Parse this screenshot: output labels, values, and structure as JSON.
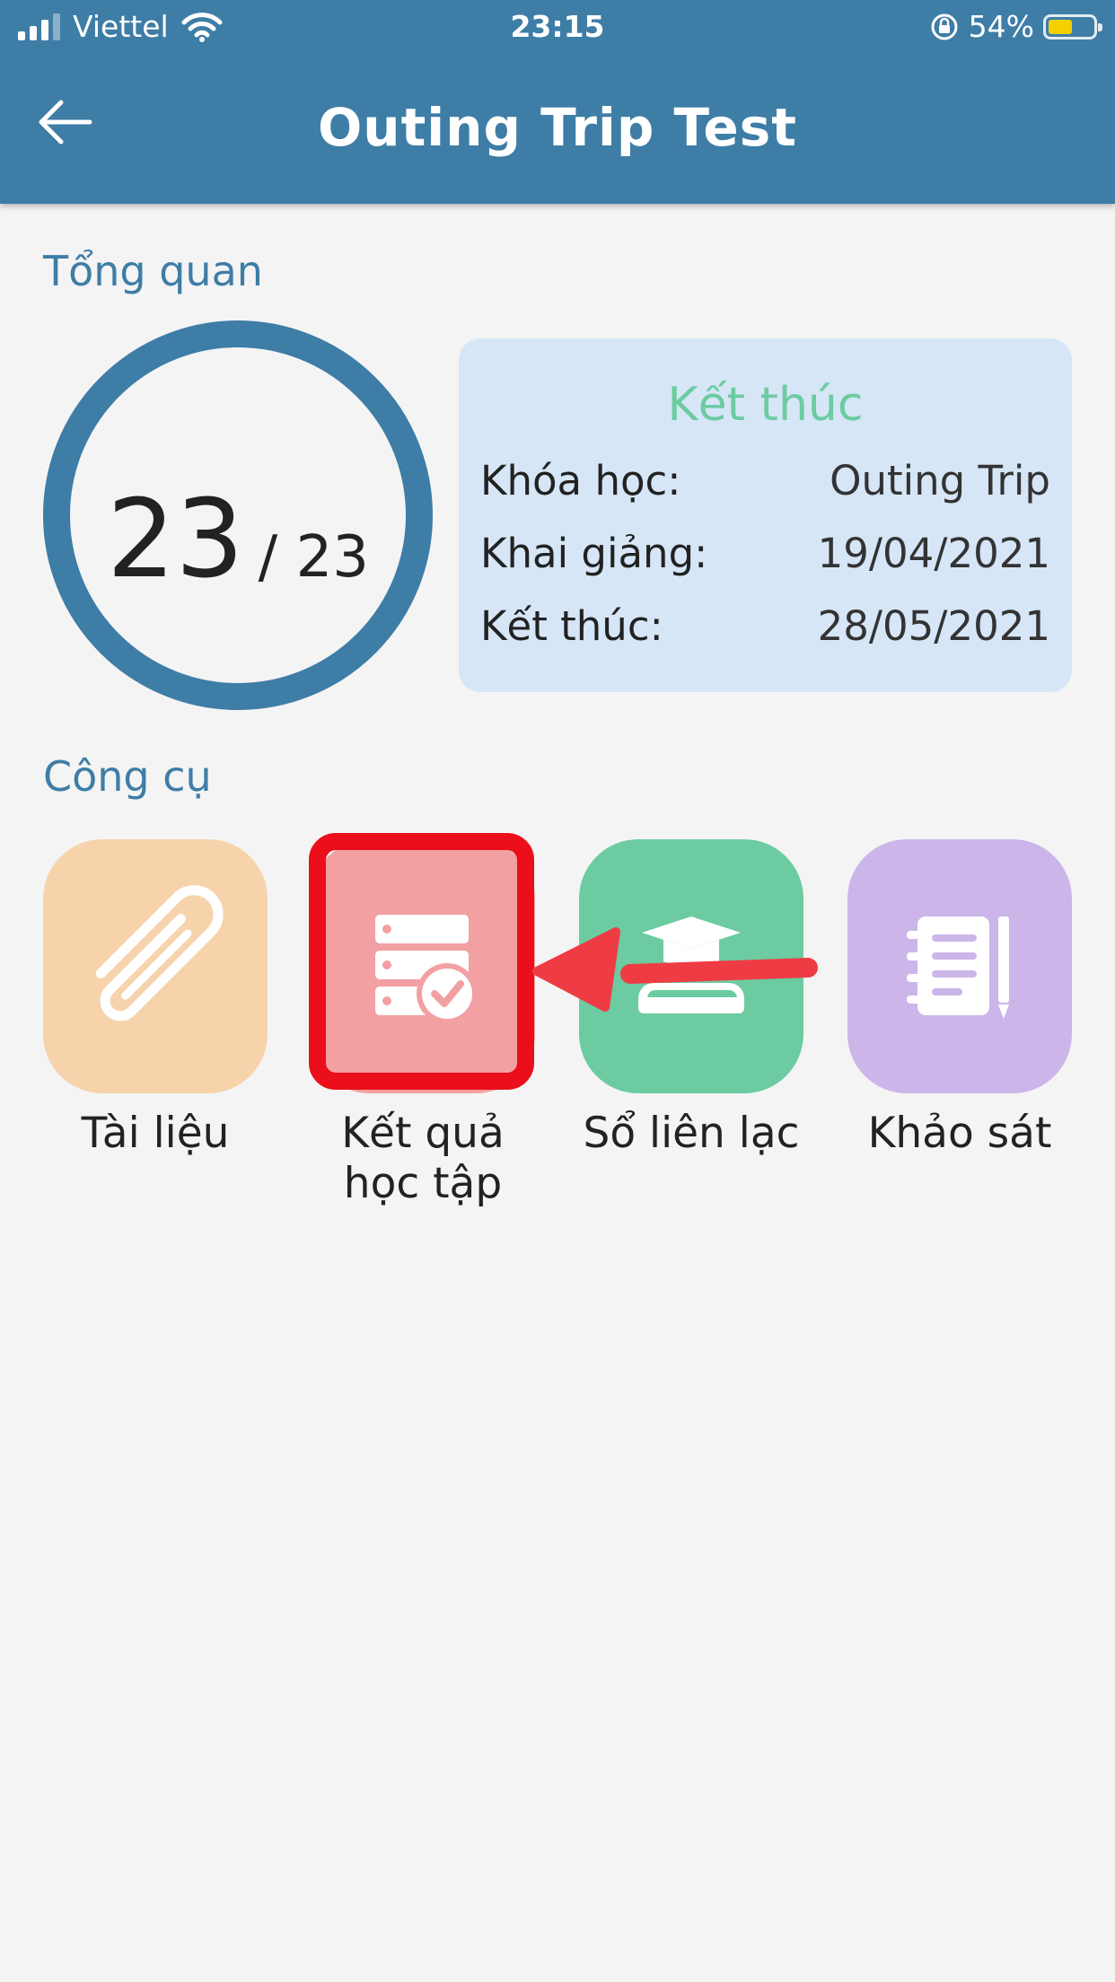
{
  "status_bar": {
    "carrier": "Viettel",
    "time": "23:15",
    "battery": "54%",
    "battery_level": 0.54
  },
  "header": {
    "title": "Outing Trip Test"
  },
  "overview": {
    "section_title": "Tổng quan",
    "progress_completed": "23",
    "progress_total": "/ 23",
    "status": "Kết thúc",
    "rows": [
      {
        "label": "Khóa học:",
        "value": "Outing Trip"
      },
      {
        "label": "Khai giảng:",
        "value": "19/04/2021"
      },
      {
        "label": "Kết thúc:",
        "value": "28/05/2021"
      }
    ]
  },
  "tools": {
    "section_title": "Công cụ",
    "items": [
      {
        "label": "Tài liệu",
        "icon": "paperclip-icon",
        "color": "#f7d3ac"
      },
      {
        "label": "Kết quả học tập",
        "icon": "results-icon",
        "color": "#f2a0a2"
      },
      {
        "label": "Sổ liên lạc",
        "icon": "graduation-book-icon",
        "color": "#6ccba1"
      },
      {
        "label": "Khảo sát",
        "icon": "notebook-icon",
        "color": "#cbb5e9"
      }
    ]
  },
  "colors": {
    "primary": "#3e7da6",
    "accent_green": "#6dcba1",
    "highlight_red": "#ea0f1a"
  }
}
